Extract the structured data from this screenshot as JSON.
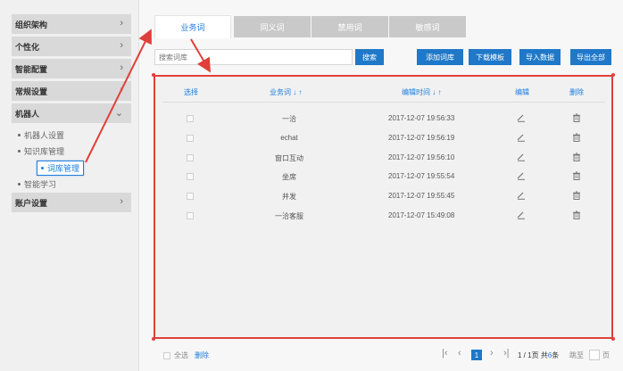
{
  "sidebar": {
    "groups": [
      {
        "label": "组织架构"
      },
      {
        "label": "个性化"
      },
      {
        "label": "智能配置"
      },
      {
        "label": "常规设置"
      },
      {
        "label": "机器人"
      },
      {
        "label": "账户设置"
      }
    ],
    "robot_items": [
      {
        "label": "机器人设置"
      },
      {
        "label": "知识库管理"
      },
      {
        "label": "词库管理"
      },
      {
        "label": "智能学习"
      }
    ]
  },
  "tabs": [
    {
      "label": "业务词"
    },
    {
      "label": "同义词"
    },
    {
      "label": "禁用词"
    },
    {
      "label": "敏感词"
    }
  ],
  "toolbar": {
    "search_placeholder": "搜索词库",
    "search_button": "搜索",
    "add": "添加词库",
    "download": "下载模板",
    "import": "导入数据",
    "export": "导出全部"
  },
  "table": {
    "headers": {
      "select": "选择",
      "word": "业务词 ↓ ↑",
      "time": "编辑时间 ↓ ↑",
      "edit": "编辑",
      "delete": "删除"
    },
    "rows": [
      {
        "word": "一洽",
        "time": "2017-12-07 19:56:33"
      },
      {
        "word": "echat",
        "time": "2017-12-07 19:56:19"
      },
      {
        "word": "窗口互动",
        "time": "2017-12-07 19:56:10"
      },
      {
        "word": "坐席",
        "time": "2017-12-07 19:55:54"
      },
      {
        "word": "并发",
        "time": "2017-12-07 19:55:45"
      },
      {
        "word": "一洽客服",
        "time": "2017-12-07 15:49:08"
      }
    ]
  },
  "footer": {
    "select_all": "全选",
    "delete": "删除",
    "page_current": "1",
    "page_info_prefix": "1 / 1",
    "page_word": "页",
    "total_word": "共",
    "total_count": "6",
    "item_word": "条",
    "jump_word": "跳至",
    "page_suffix": "页"
  },
  "colors": {
    "accent": "#1c7de0",
    "annotation": "#e0403a",
    "button": "#1f78c8"
  }
}
